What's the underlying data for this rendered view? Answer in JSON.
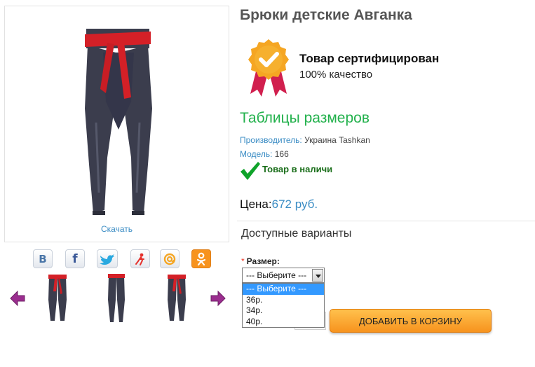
{
  "product": {
    "title": "Брюки детские Авганка",
    "download_label": "Скачать"
  },
  "certificate": {
    "title": "Товар сертифицирован",
    "subtitle": "100% качество"
  },
  "size_tables_link": "Таблицы размеров",
  "meta": {
    "manufacturer_label": "Производитель:",
    "manufacturer_value": " Украина Tashkan",
    "model_label": "Модель:",
    "model_value": " 166"
  },
  "stock": {
    "status": "Товар в наличи"
  },
  "price": {
    "label": "Цена:",
    "value": "672 руб."
  },
  "options": {
    "title": "Доступные варианты",
    "size_required_mark": "*",
    "size_label": "Размер:",
    "selected_value": "--- Выберите ---",
    "dropdown_options": [
      "--- Выберите ---",
      "36р.",
      "34р.",
      "40р."
    ]
  },
  "cart": {
    "button_label": "ДОБАВИТЬ В КОРЗИНУ",
    "quantity": ""
  },
  "share": {
    "buttons": [
      "vkontakte",
      "facebook",
      "twitter",
      "moi-mir",
      "mail-ru",
      "odnoklassniki"
    ],
    "vk_glyph": "B",
    "fb_glyph": "f"
  },
  "colors": {
    "accent_blue": "#3a8cc4",
    "accent_green": "#22b14c",
    "cart_orange": "#f7931e",
    "pants_gray": "#3b3d4d",
    "sash_red": "#d42027",
    "arrow_purple": "#9b2d8f"
  }
}
